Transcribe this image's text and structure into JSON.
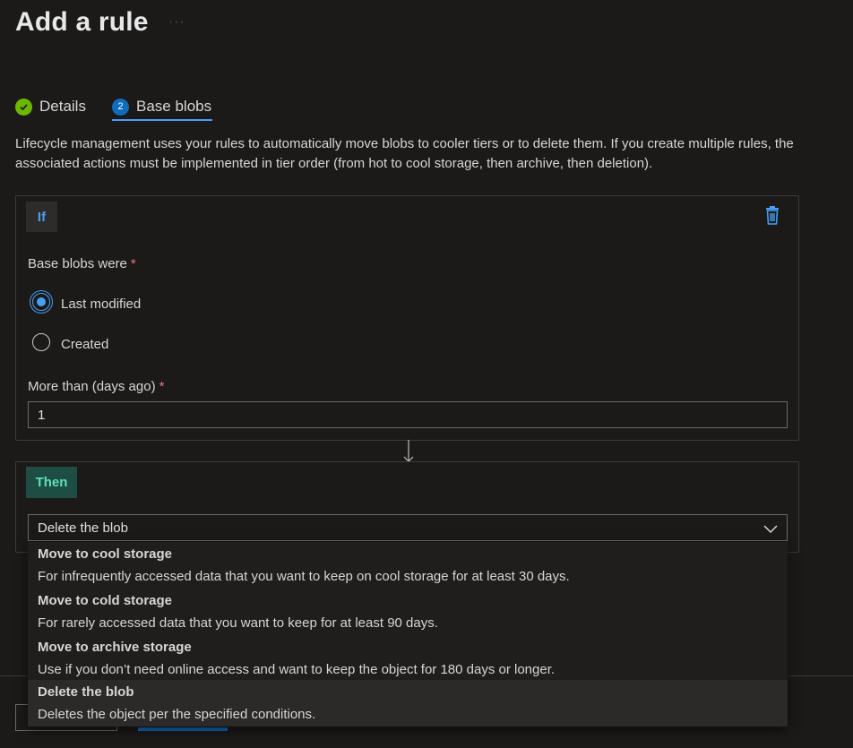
{
  "page": {
    "title": "Add a rule",
    "title_menu": "···"
  },
  "tabs": [
    {
      "label": "Details",
      "step": ""
    },
    {
      "label": "Base blobs",
      "step": "2"
    }
  ],
  "description": "Lifecycle management uses your rules to automatically move blobs to cooler tiers or to delete them. If you create multiple rules, the associated actions must be implemented in tier order (from hot to cool storage, then archive, then deletion).",
  "if_block": {
    "badge": "If",
    "base_blobs_label": "Base blobs were",
    "required_mark": "*",
    "radio_options": [
      "Last modified",
      "Created"
    ],
    "selected_radio": "Last modified",
    "days_label": "More than (days ago)",
    "days_value": "1"
  },
  "then_block": {
    "badge": "Then",
    "selected_action": "Delete the blob",
    "options": [
      {
        "title": "Move to cool storage",
        "desc": "For infrequently accessed data that you want to keep on cool storage for at least 30 days."
      },
      {
        "title": "Move to cold storage",
        "desc": "For rarely accessed data that you want to keep for at least 90 days."
      },
      {
        "title": "Move to archive storage",
        "desc": "Use if you don’t need online access and want to keep the object for 180 days or longer."
      },
      {
        "title": "Delete the blob",
        "desc": "Deletes the object per the specified conditions."
      }
    ]
  },
  "colors": {
    "accent": "#479ef5",
    "success": "#6bb700",
    "then_badge": "#1e4e43",
    "required": "#f1707b"
  },
  "icons": {
    "delete": "trash-icon",
    "tab_done": "check-circle-icon",
    "dropdown": "chevron-down-icon",
    "connector": "arrow-down-icon"
  }
}
